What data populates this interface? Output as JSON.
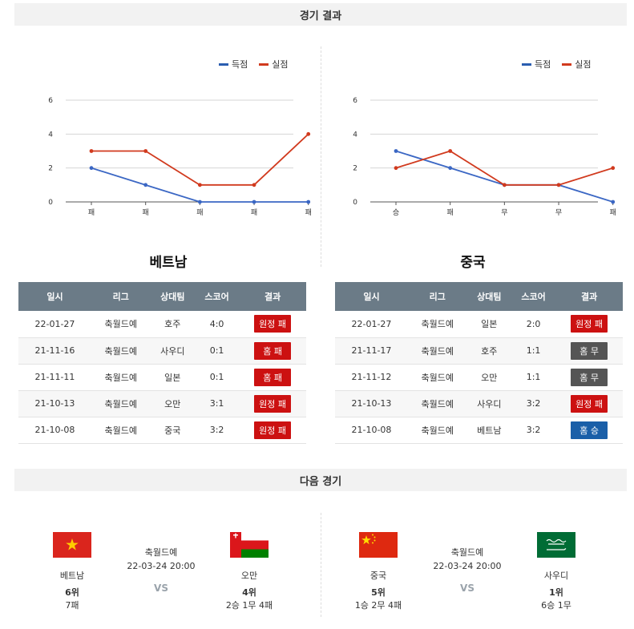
{
  "section_results": "경기 결과",
  "section_next": "다음 경기",
  "legend": {
    "scored": "득점",
    "conceded": "실점",
    "scored_color": "#2a5db0",
    "conceded_color": "#d13a1e"
  },
  "chart_data": [
    {
      "type": "line",
      "categories": [
        "패",
        "패",
        "패",
        "패",
        "패"
      ],
      "ylim": [
        0,
        6
      ],
      "yticks": [
        0,
        2,
        4,
        6
      ],
      "series": [
        {
          "name": "득점",
          "values": [
            2,
            1,
            0,
            0,
            0
          ],
          "color": "#3b67c4"
        },
        {
          "name": "실점",
          "values": [
            3,
            3,
            1,
            1,
            4
          ],
          "color": "#d13a1e"
        }
      ],
      "legend_position": "top-right",
      "grid": true
    },
    {
      "type": "line",
      "categories": [
        "승",
        "패",
        "무",
        "무",
        "패"
      ],
      "ylim": [
        0,
        6
      ],
      "yticks": [
        0,
        2,
        4,
        6
      ],
      "series": [
        {
          "name": "득점",
          "values": [
            3,
            2,
            1,
            1,
            0
          ],
          "color": "#3b67c4"
        },
        {
          "name": "실점",
          "values": [
            2,
            3,
            1,
            1,
            2
          ],
          "color": "#d13a1e"
        }
      ],
      "legend_position": "top-right",
      "grid": true
    }
  ],
  "columns": [
    "일시",
    "리그",
    "상대팀",
    "스코어",
    "결과"
  ],
  "teams": [
    {
      "name": "베트남",
      "rows": [
        {
          "date": "22-01-27",
          "league": "축월드예",
          "opponent": "호주",
          "score": "4:0",
          "result": "원정 패",
          "color": "#cc1111"
        },
        {
          "date": "21-11-16",
          "league": "축월드예",
          "opponent": "사우디",
          "score": "0:1",
          "result": "홈 패",
          "color": "#cc1111"
        },
        {
          "date": "21-11-11",
          "league": "축월드예",
          "opponent": "일본",
          "score": "0:1",
          "result": "홈 패",
          "color": "#cc1111"
        },
        {
          "date": "21-10-13",
          "league": "축월드예",
          "opponent": "오만",
          "score": "3:1",
          "result": "원정 패",
          "color": "#cc1111"
        },
        {
          "date": "21-10-08",
          "league": "축월드예",
          "opponent": "중국",
          "score": "3:2",
          "result": "원정 패",
          "color": "#cc1111"
        }
      ]
    },
    {
      "name": "중국",
      "rows": [
        {
          "date": "22-01-27",
          "league": "축월드예",
          "opponent": "일본",
          "score": "2:0",
          "result": "원정 패",
          "color": "#cc1111"
        },
        {
          "date": "21-11-17",
          "league": "축월드예",
          "opponent": "호주",
          "score": "1:1",
          "result": "홈 무",
          "color": "#555555"
        },
        {
          "date": "21-11-12",
          "league": "축월드예",
          "opponent": "오만",
          "score": "1:1",
          "result": "홈 무",
          "color": "#555555"
        },
        {
          "date": "21-10-13",
          "league": "축월드예",
          "opponent": "사우디",
          "score": "3:2",
          "result": "원정 패",
          "color": "#cc1111"
        },
        {
          "date": "21-10-08",
          "league": "축월드예",
          "opponent": "베트남",
          "score": "3:2",
          "result": "홈 승",
          "color": "#1a5fa8"
        }
      ]
    }
  ],
  "next_matches": [
    {
      "home": {
        "name": "베트남",
        "rank": "6위",
        "record": "7패",
        "flag": "vietnam-flag"
      },
      "away": {
        "name": "오만",
        "rank": "4위",
        "record": "2승 1무 4패",
        "flag": "oman-flag"
      },
      "league": "축월드예",
      "datetime": "22-03-24 20:00",
      "vs": "VS"
    },
    {
      "home": {
        "name": "중국",
        "rank": "5위",
        "record": "1승 2무 4패",
        "flag": "china-flag"
      },
      "away": {
        "name": "사우디",
        "rank": "1위",
        "record": "6승 1무",
        "flag": "saudi-flag"
      },
      "league": "축월드예",
      "datetime": "22-03-24 20:00",
      "vs": "VS"
    }
  ]
}
